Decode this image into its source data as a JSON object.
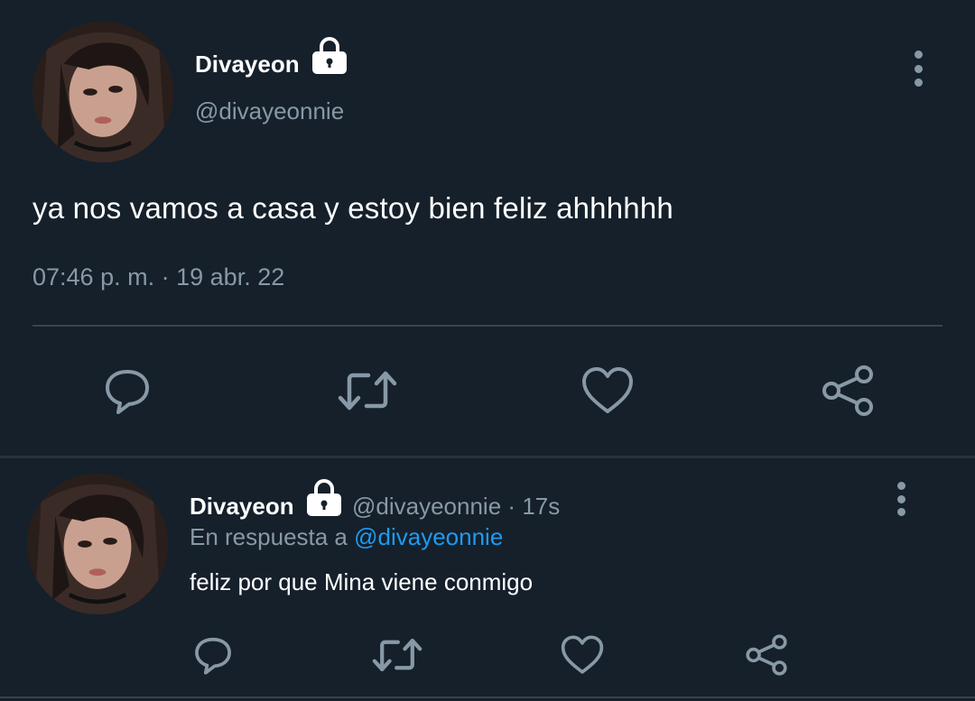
{
  "colors": {
    "background": "#15202b",
    "text_primary": "#ffffff",
    "text_secondary": "#8899a6",
    "divider": "#38444d",
    "link": "#1d9bf0"
  },
  "main_tweet": {
    "display_name": "Divayeon",
    "handle": "@divayeonnie",
    "protected_icon": "lock-icon",
    "text": "ya nos vamos a casa y estoy bien feliz ahhhhhh",
    "time": "07:46 p. m.",
    "separator": "·",
    "date": "19 abr. 22",
    "actions": [
      "reply-icon",
      "retweet-icon",
      "like-icon",
      "share-icon"
    ]
  },
  "reply_tweet": {
    "display_name": "Divayeon",
    "protected_icon": "lock-icon",
    "handle": "@divayeonnie",
    "separator": "·",
    "age": "17s",
    "reply_prefix": "En respuesta a",
    "reply_to": "@divayeonnie",
    "text": "feliz por que Mina viene conmigo",
    "actions": [
      "reply-icon",
      "retweet-icon",
      "like-icon",
      "share-icon"
    ]
  }
}
